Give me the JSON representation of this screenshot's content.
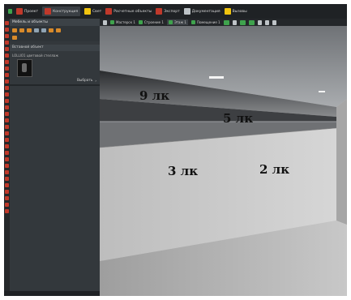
{
  "toolbar": {
    "items": [
      {
        "label": "Проект",
        "icon": "project-icon",
        "color": "#c0392b"
      },
      {
        "label": "Конструкция",
        "icon": "construction-icon",
        "color": "#c0392b",
        "active": true
      },
      {
        "label": "Свет",
        "icon": "light-icon",
        "color": "#f1c40f"
      },
      {
        "label": "Расчетные объекты",
        "icon": "calc-objects-icon",
        "color": "#c0392b"
      },
      {
        "label": "Экспорт",
        "icon": "export-icon",
        "color": "#c0392b"
      },
      {
        "label": "Документация",
        "icon": "documentation-icon",
        "color": "#bdc3c7"
      },
      {
        "label": "Вызовы",
        "icon": "calls-icon",
        "color": "#f1c40f"
      }
    ]
  },
  "panel": {
    "title": "Мебель и объекты",
    "section": "Вставной объект",
    "object_label": "LOLLIO1 цветовой стеллаж",
    "pick_label": "Выбрать",
    "status": "ready"
  },
  "viewport_tabs": [
    {
      "label": "Мастерск 1"
    },
    {
      "label": "Строение 1"
    },
    {
      "label": "Этаж 1",
      "active": true
    },
    {
      "label": "Помещение 1"
    }
  ],
  "illuminance_labels": {
    "label_9": "9 лк",
    "label_5": "5 лк",
    "label_3": "3 лк",
    "label_2": "2 лк"
  },
  "colors": {
    "accent_red": "#c0392b",
    "accent_green": "#3fa34d",
    "accent_orange": "#d88a2a",
    "app_background": "#2e3236"
  }
}
